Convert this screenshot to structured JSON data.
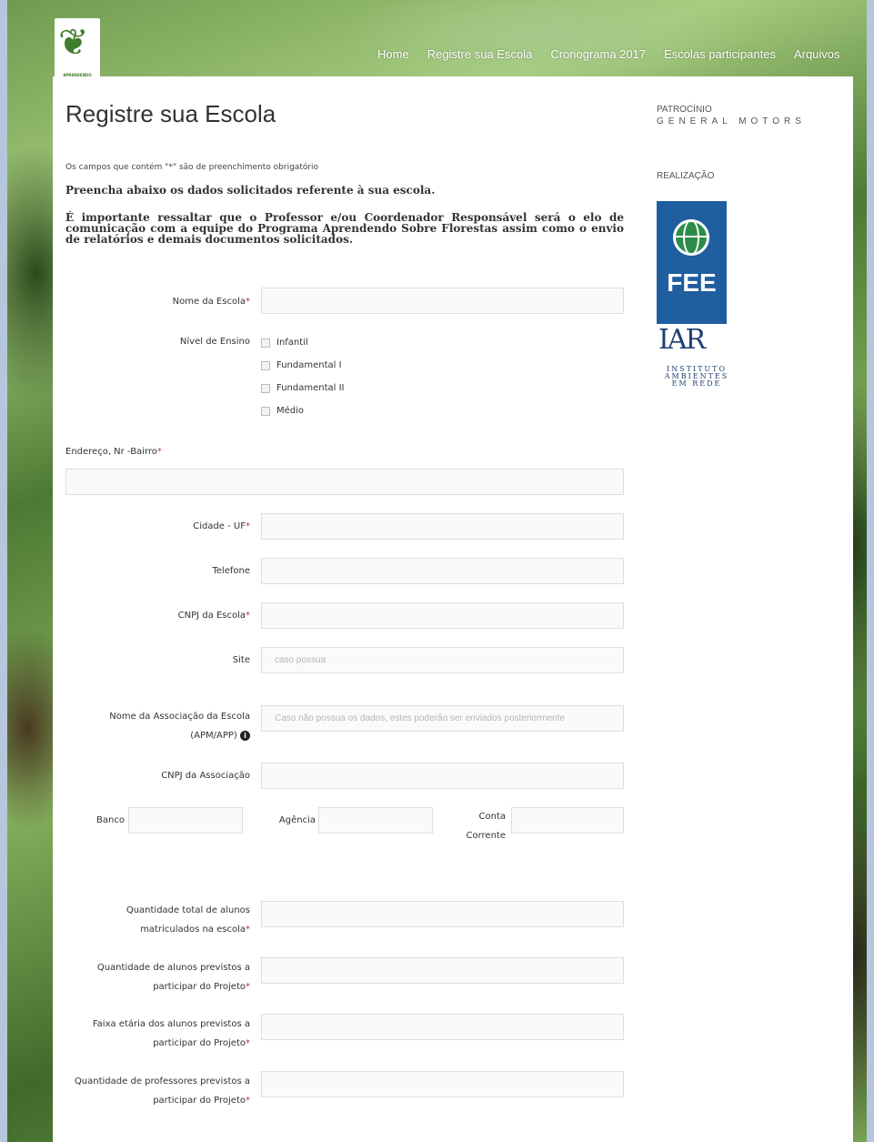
{
  "nav": {
    "items": [
      "Home",
      "Registre sua Escola",
      "Cronograma 2017",
      "Escolas participantes",
      "Arquivos"
    ]
  },
  "logo": {
    "text": "APRENDENDO SOBRE FLORESTAS",
    "color": "#3f7d2b"
  },
  "page": {
    "title": "Registre sua Escola",
    "required_note": "Os campos que contém \"*\" são de preenchimento obrigatório",
    "lead": "Preencha abaixo os dados solicitados referente à sua escola.",
    "info": "É importante ressaltar que o Professor e/ou Coordenador Responsável será o elo de comunicação com a equipe do Programa Aprendendo Sobre Florestas assim como o envio de relatórios e demais documentos solicitados."
  },
  "form": {
    "required_mark": "*",
    "nome_escola": {
      "label": "Nome da Escola",
      "value": ""
    },
    "nivel_ensino": {
      "label": "Nível de Ensino",
      "options": [
        "Infantil",
        "Fundamental I",
        "Fundamental II",
        "Médio"
      ]
    },
    "endereco": {
      "label": "Endereço, Nr -Bairro",
      "value": ""
    },
    "cidade_uf": {
      "label": "Cidade - UF",
      "value": ""
    },
    "telefone": {
      "label": "Telefone",
      "value": ""
    },
    "cnpj_escola": {
      "label": "CNPJ da Escola",
      "value": ""
    },
    "site": {
      "label": "Site",
      "placeholder": "caso possua"
    },
    "associacao": {
      "label_line1": "Nome da Associação da Escola",
      "label_line2": "(APM/APP)",
      "placeholder": "Caso não possua os dados, estes poderão ser enviados posteriormente"
    },
    "cnpj_associacao": {
      "label": "CNPJ da Associação",
      "value": ""
    },
    "banco": {
      "label": "Banco",
      "value": ""
    },
    "agencia": {
      "label": "Agência",
      "value": ""
    },
    "conta": {
      "label_line1": "Conta",
      "label_line2": "Corrente",
      "value": ""
    },
    "qtd_alunos": {
      "label_line1": "Quantidade total de alunos",
      "label_line2": "matriculados na escola"
    },
    "qtd_previstos": {
      "label_line1": "Quantidade de alunos previstos a",
      "label_line2": "participar do Projeto"
    },
    "faixa_etaria": {
      "label_line1": "Faixa etária dos alunos previstos a",
      "label_line2": "participar do Projeto"
    },
    "qtd_professores": {
      "label_line1": "Quantidade de professores previstos a",
      "label_line2": "participar do Projeto"
    }
  },
  "sidebar": {
    "patrocinio_label": "PATROCÍNIO",
    "patrocinio_name": "GENERAL MOTORS",
    "realizacao_label": "REALIZAÇÃO",
    "fee_text": "FEE",
    "fee_color": "#1f5e9f",
    "iar_text": "IAR",
    "iar_sub": "INSTITUTO AMBIENTES EM REDE"
  }
}
